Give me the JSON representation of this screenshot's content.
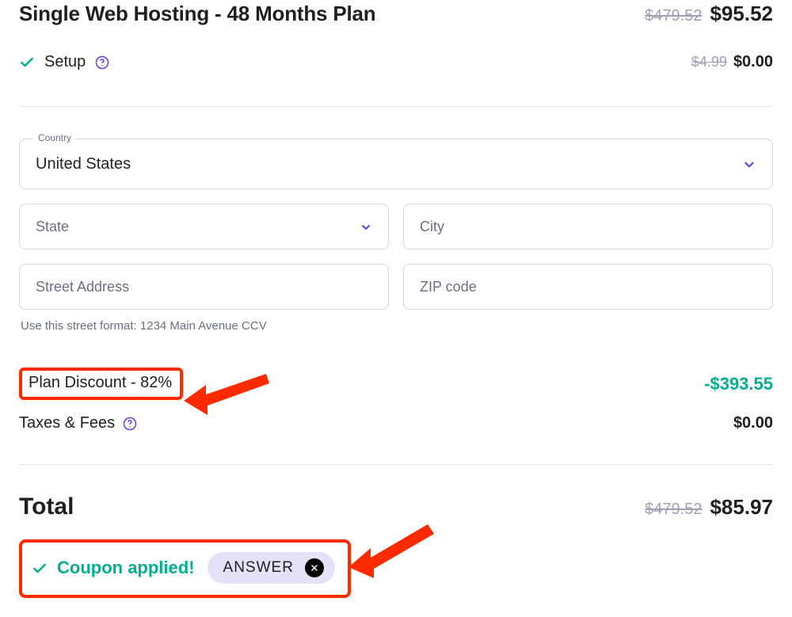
{
  "plan": {
    "title": "Single Web Hosting - 48 Months Plan",
    "original_price": "$479.52",
    "price": "$95.52"
  },
  "setup": {
    "label": "Setup",
    "original_price": "$4.99",
    "price": "$0.00"
  },
  "form": {
    "country_label": "Country",
    "country_value": "United States",
    "state_placeholder": "State",
    "city_placeholder": "City",
    "street_placeholder": "Street Address",
    "zip_placeholder": "ZIP code",
    "street_hint": "Use this street format: 1234 Main Avenue CCV"
  },
  "discount": {
    "label": "Plan Discount - 82%",
    "amount": "-$393.55"
  },
  "taxes": {
    "label": "Taxes & Fees",
    "amount": "$0.00"
  },
  "total": {
    "label": "Total",
    "original_price": "$479.52",
    "price": "$85.97"
  },
  "coupon": {
    "applied_text": "Coupon applied!",
    "code": "ANSWER"
  },
  "colors": {
    "accent_purple": "#673de6",
    "success_green": "#00b090",
    "annotation_red": "#ff2a00"
  }
}
